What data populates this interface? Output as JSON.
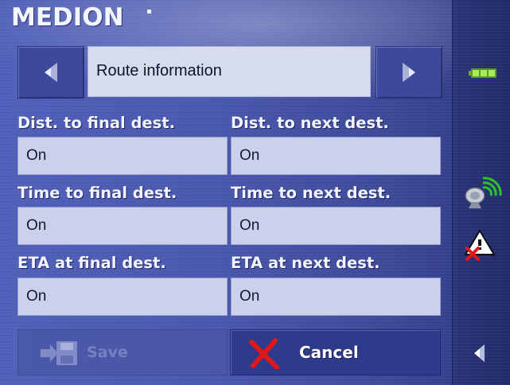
{
  "brand": {
    "logo_text": "MEDION"
  },
  "header": {
    "title": "Route information",
    "prev_icon": "chevron-left-icon",
    "next_icon": "chevron-right-icon"
  },
  "settings": [
    {
      "label": "Dist. to final dest.",
      "value": "On"
    },
    {
      "label": "Dist. to next dest.",
      "value": "On"
    },
    {
      "label": "Time to final dest.",
      "value": "On"
    },
    {
      "label": "Time to next dest.",
      "value": "On"
    },
    {
      "label": "ETA at final dest.",
      "value": "On"
    },
    {
      "label": "ETA at next dest.",
      "value": "On"
    }
  ],
  "actions": {
    "save_label": "Save",
    "cancel_label": "Cancel"
  },
  "sidebar": {
    "icons": [
      "battery-icon",
      "gps-satellite-icon",
      "tmc-warning-icon",
      "back-arrow-icon"
    ]
  },
  "colors": {
    "background": "#4a58ae",
    "sidebar": "#252d6c",
    "field": "#cbd1ea",
    "cancel_x": "#e01818",
    "battery": "#8fd640",
    "gps_signal": "#3cc83c"
  }
}
